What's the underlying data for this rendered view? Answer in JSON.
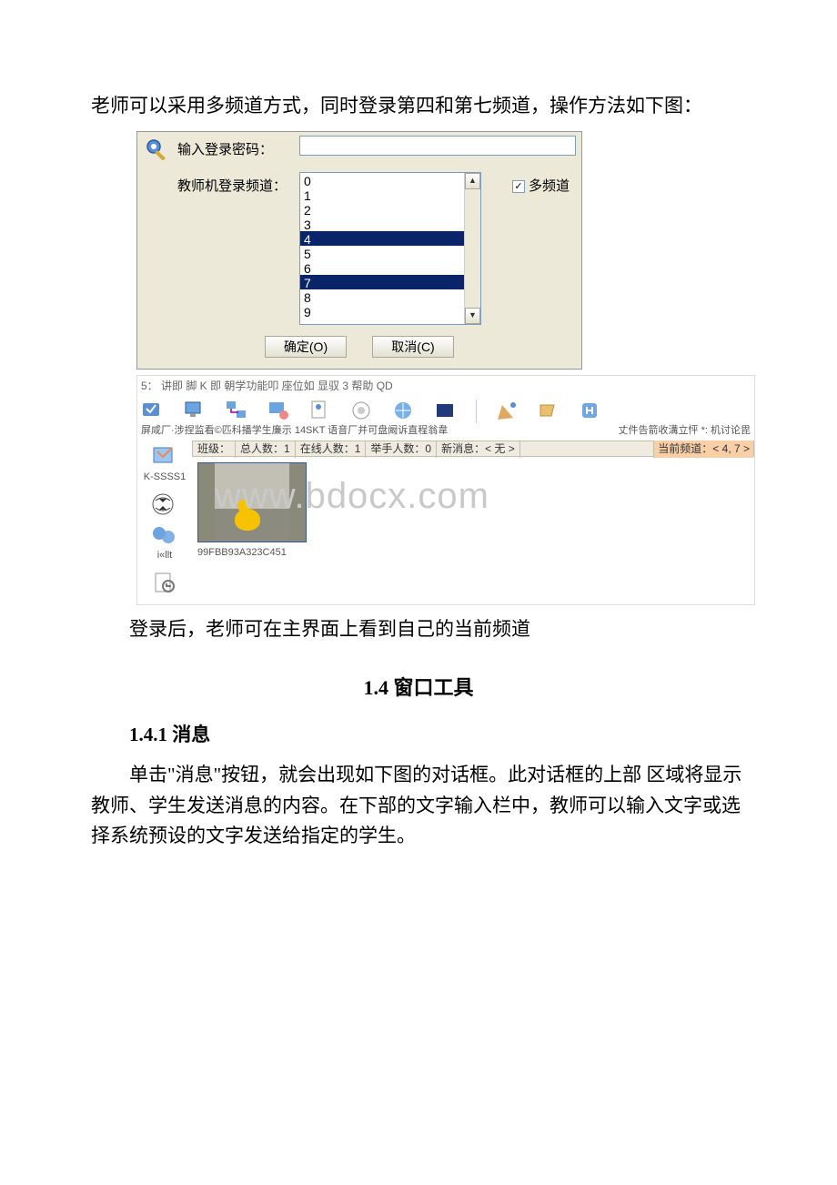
{
  "para1": "老师可以采用多频道方式，同时登录第四和第七频道，操作方法如下图：",
  "dialog": {
    "password_label": "输入登录密码：",
    "channel_label": "教师机登录频道：",
    "channels": [
      "0",
      "1",
      "2",
      "3",
      "4",
      "5",
      "6",
      "7",
      "8",
      "9"
    ],
    "selected_channels": [
      4,
      7
    ],
    "multi_checkbox_label": "多频道",
    "multi_checked": true,
    "ok": "确定(O)",
    "cancel": "取消(C)"
  },
  "iface": {
    "menubar": "5： 讲即 脚 K 即 朝学功能叩 座位如 显驭 3 帮助 QD",
    "toolbar_label_left": "屏咸厂·涉捏监看©匹科播学生廉示 14SKT 语音厂并可盘阚诉直程翁韋",
    "toolbar_label_right": "丈件告箭收溝立怦 *: 机讨论毘",
    "status": {
      "class": "班级：",
      "total": "总人数：1",
      "online": "在线人数：1",
      "hands": "举手人数：0",
      "newmsg": "新消息：< 无 >",
      "current": "当前频道：< 4, 7 >"
    },
    "side": {
      "item1": "K-SSSS1",
      "item2": "",
      "item3": "i«llt"
    },
    "thumbnail_id": "99FBB93A323C451"
  },
  "watermark": "www.bdocx.com",
  "caption": "登录后，老师可在主界面上看到自己的当前频道",
  "section_title": "1.4 窗口工具",
  "subsection_title": "1.4.1 消息",
  "body_text": "单击\"消息\"按钮，就会出现如下图的对话框。此对话框的上部 区域将显示教师、学生发送消息的内容。在下部的文字输入栏中，教师可以输入文字或选择系统预设的文字发送给指定的学生。"
}
